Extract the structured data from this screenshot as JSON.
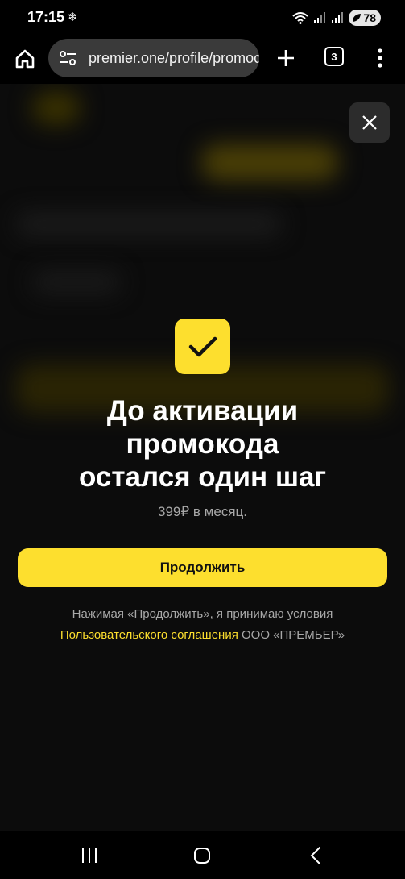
{
  "status_bar": {
    "time": "17:15",
    "extra_icon": "❄",
    "battery_level": "78"
  },
  "browser": {
    "url": "premier.one/profile/promocode",
    "tab_count": "3"
  },
  "modal": {
    "title_lines": [
      "До активации",
      "промокода",
      "остался один шаг"
    ],
    "price": "399₽ в месяц.",
    "continue_label": "Продолжить",
    "terms_prefix": "Нажимая «Продолжить», я принимаю условия",
    "terms_link": "Пользовательского соглашения",
    "terms_suffix": " ООО «ПРЕМЬЕР»"
  },
  "colors": {
    "accent": "#fddf2e",
    "background": "#0c0c0c",
    "muted_text": "#a8a8a8"
  }
}
